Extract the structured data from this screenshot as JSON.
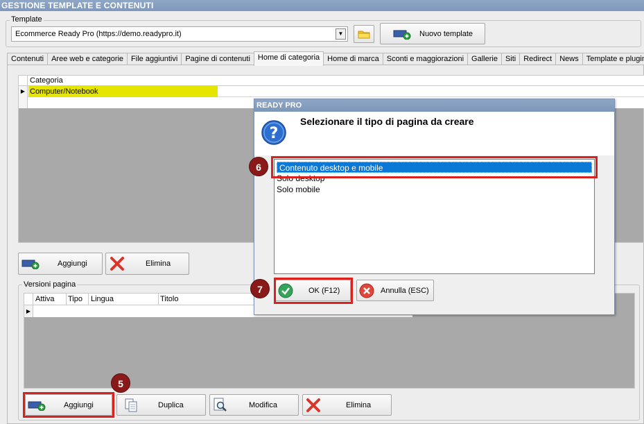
{
  "window": {
    "title": "GESTIONE TEMPLATE E CONTENUTI"
  },
  "template_group": {
    "label": "Template",
    "selected_value": "Ecommerce Ready Pro (https://demo.readypro.it)",
    "new_button_label": "Nuovo template"
  },
  "tabs": [
    {
      "label": "Contenuti"
    },
    {
      "label": "Aree web e categorie"
    },
    {
      "label": "File aggiuntivi"
    },
    {
      "label": "Pagine di contenuti"
    },
    {
      "label": "Home di categoria"
    },
    {
      "label": "Home di marca"
    },
    {
      "label": "Sconti e maggiorazioni"
    },
    {
      "label": "Gallerie"
    },
    {
      "label": "Siti"
    },
    {
      "label": "Redirect"
    },
    {
      "label": "News"
    },
    {
      "label": "Template e plugins"
    }
  ],
  "active_tab": "Home di categoria",
  "category_grid": {
    "header": "Categoria",
    "rows": [
      "Computer/Notebook"
    ],
    "highlight_color": "#e5e500"
  },
  "category_buttons": {
    "add": "Aggiungi",
    "delete": "Elimina"
  },
  "versions": {
    "label": "Versioni pagina",
    "columns": [
      "Attiva",
      "Tipo",
      "Lingua",
      "Titolo"
    ]
  },
  "version_buttons": {
    "add": "Aggiungi",
    "duplicate": "Duplica",
    "edit": "Modifica",
    "delete": "Elimina"
  },
  "dialog": {
    "title": "READY PRO",
    "message": "Selezionare il tipo di pagina da creare",
    "options": [
      "Contenuto desktop e mobile",
      "Solo desktop",
      "Solo mobile"
    ],
    "selected_option": "Contenuto desktop e mobile",
    "ok_label": "OK (F12)",
    "cancel_label": "Annulla (ESC)"
  },
  "markers": {
    "five": "5",
    "six": "6",
    "seven": "7"
  },
  "colors": {
    "marker_red": "#8a1a1a",
    "highlight_border": "#d9221d",
    "selection_blue": "#0b78d7",
    "titlebar": "#8ba3c3"
  }
}
